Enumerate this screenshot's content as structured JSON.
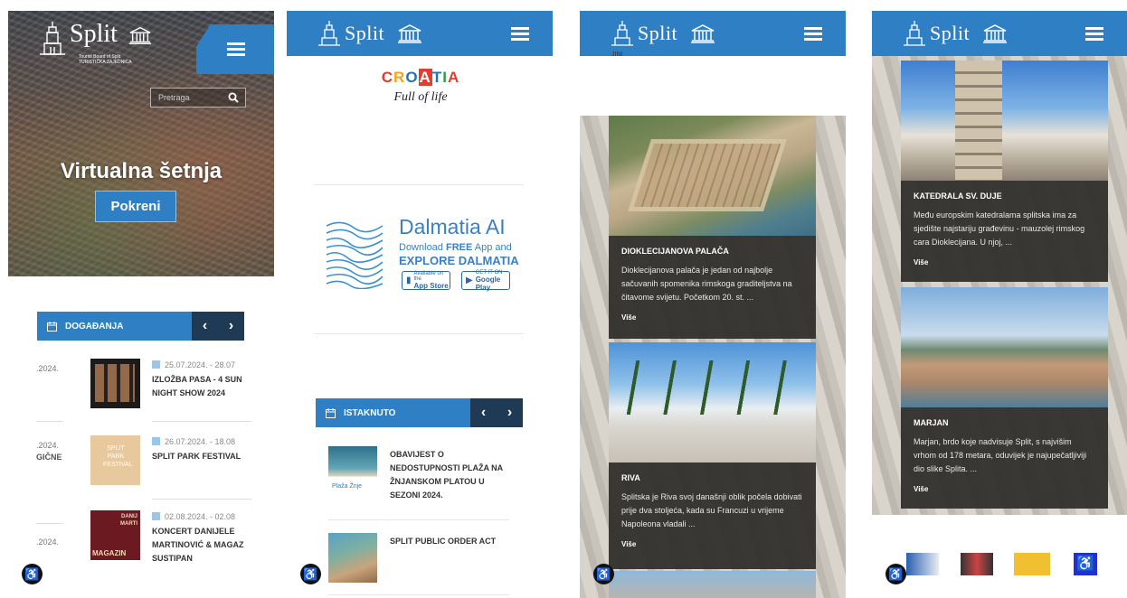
{
  "brand": {
    "word": "Split",
    "subtitle": "Tourist Board of Split",
    "subtitle2": "TURISTIČKA ZAJEDNICA"
  },
  "panel1": {
    "search_placeholder": "Pretraga",
    "hero_title": "Virtualna šetnja",
    "hero_button": "Pokreni",
    "events_header": "DOGAĐANJA",
    "events": [
      {
        "year": ".2024.",
        "year2": "",
        "date": "25.07.2024. - 28.07",
        "name": "IZLOŽBA PASA - 4 SUN NIGHT SHOW 2024",
        "line1": "IZLOŽBA PASA - 4 SUN",
        "line2": "NIGHT SHOW 2024",
        "thumb_color": "#1d1a1a"
      },
      {
        "year": ".2024.",
        "year2": "GIČNE",
        "date": "26.07.2024. - 18.08",
        "name": "SPLIT PARK FESTIVAL",
        "line1": "SPLIT PARK FESTIVAL",
        "line2": "",
        "thumb_color": "#e8c89d"
      },
      {
        "year": ".2024.",
        "year2": "",
        "date": "02.08.2024. - 02.08",
        "name": "KONCERT DANIJELE MARTINOVIĆ & MAGAZIN SUSTIPAN",
        "line1": "KONCERT DANIJELE",
        "line2": "MARTINOVIĆ & MAGAZ",
        "line3": "SUSTIPAN",
        "thumb_color": "#6b1a22"
      }
    ]
  },
  "panel2": {
    "croatia_word": "CROATIA",
    "croatia_tag": "Full of life",
    "dalmatia_title": "Dalmatia AI",
    "dalmatia_l2_a": "Download ",
    "dalmatia_l2_b": "FREE",
    "dalmatia_l2_c": " App and",
    "dalmatia_l3": "EXPLORE DALMATIA",
    "appstore_small": "Available on the",
    "appstore": "App Store",
    "googleplay_small": "GET IT ON",
    "googleplay": "Google Play",
    "featured_header": "ISTAKNUTO",
    "featured": [
      {
        "lines": [
          "OBAVIJEST O",
          "NEDOSTUPNOSTI PLAŽA NA",
          "ŽNJANSKOM PLATOU U",
          "SEZONI 2024."
        ],
        "thumb_label": "Plaža Žnje"
      },
      {
        "lines": [
          "SPLIT PUBLIC ORDER ACT"
        ],
        "thumb_label": ""
      }
    ]
  },
  "panel3": {
    "ghost_text": "JINI",
    "cards": [
      {
        "title": "DIOKLECIJANOVA PALAČA",
        "desc": "Dioklecijanova palača je jedan od najbolje sačuvanih spomenika rimskoga graditeljstva na čitavome svijetu. Početkom 20. st. ...",
        "more": "Više"
      },
      {
        "title": "RIVA",
        "desc": "Splitska je Riva svoj današnji oblik počela dobivati prije dva stoljeća, kada su Francuzi u vrijeme Napoleona vladali ...",
        "more": "Više"
      }
    ]
  },
  "panel4": {
    "cards": [
      {
        "title": "KATEDRALA SV. DUJE",
        "desc": "Među europskim katedralama splitska ima za sjedište najstariju građevinu - mauzolej rimskog cara Dioklecijana. U njoj, ...",
        "more": "Više"
      },
      {
        "title": "MARJAN",
        "desc": "Marjan, brdo koje nadvisuje Split, s najvišim vrhom od 178 metara, oduvijek je najupečatljiviji dio slike Splita. ...",
        "more": "Više"
      }
    ]
  },
  "accessibility_icon": "♿",
  "colors": {
    "brand_blue": "#2f7fc4",
    "dark_navy": "#1f3a55",
    "card_dark": "#2d2a28"
  }
}
